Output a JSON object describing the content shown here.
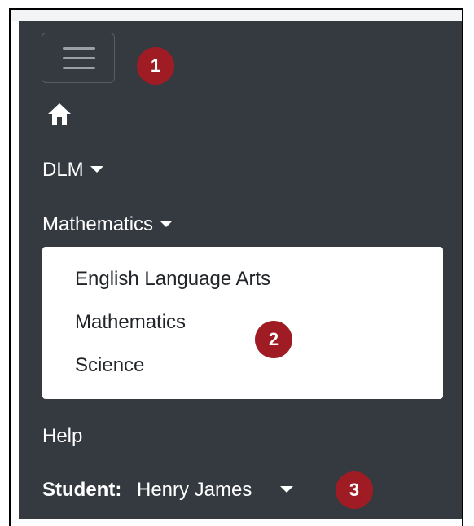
{
  "navbar": {
    "menu_toggle_icon": "hamburger-icon",
    "home_icon": "home-icon",
    "items": {
      "dlm": "DLM",
      "subject": "Mathematics",
      "help": "Help"
    },
    "subject_dropdown": {
      "options": [
        "English Language Arts",
        "Mathematics",
        "Science"
      ]
    },
    "student": {
      "label": "Student:",
      "name": "Henry James"
    }
  },
  "callouts": [
    "1",
    "2",
    "3"
  ],
  "colors": {
    "navbar_bg": "#343a40",
    "badge_bg": "#a01c24",
    "dropdown_bg": "#ffffff"
  }
}
